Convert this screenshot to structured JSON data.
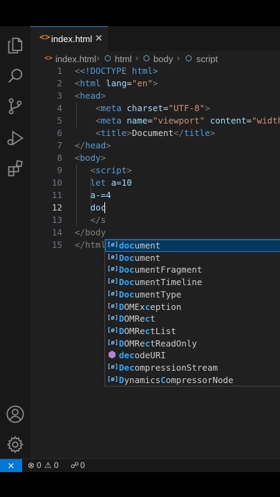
{
  "tab": {
    "icon": "html-file-icon",
    "label": "index.html",
    "close": "✕"
  },
  "breadcrumb": {
    "file": "index.html",
    "items": [
      "html",
      "body",
      "script"
    ]
  },
  "line_numbers": [
    "1",
    "2",
    "3",
    "4",
    "5",
    "6",
    "7",
    "8",
    "9",
    "10",
    "11",
    "12",
    "13",
    "14",
    "15"
  ],
  "active_line": "12",
  "code": {
    "l1": "<!DOCTYPE html>",
    "l2_tag": "html",
    "l2_attr": "lang",
    "l2_val": "\"en\"",
    "l3": "head",
    "l4_tag": "meta",
    "l4_attr": "charset",
    "l4_val": "\"UTF-8\"",
    "l5_tag": "meta",
    "l5_attr1": "name",
    "l5_val1": "\"viewport\"",
    "l5_attr2": "content",
    "l5_val2": "\"width=",
    "l6_tag": "title",
    "l6_text": "Document",
    "l7": "head",
    "l8": "body",
    "l9": "script",
    "l10_kw": "let",
    "l10_rest": "a=10",
    "l11": "a-=4",
    "l12": "doc",
    "l13": "</s",
    "l14": "</body",
    "l15": "</html"
  },
  "suggestions": [
    {
      "icon": "variable-icon",
      "match": "doc",
      "rest": "ument"
    },
    {
      "icon": "variable-icon",
      "match": "Doc",
      "rest": "ument"
    },
    {
      "icon": "variable-icon",
      "match": "Doc",
      "rest": "umentFragment"
    },
    {
      "icon": "variable-icon",
      "match": "Doc",
      "rest": "umentTimeline"
    },
    {
      "icon": "variable-icon",
      "match": "Doc",
      "rest": "umentType"
    },
    {
      "icon": "variable-icon",
      "pre": "",
      "parts": [
        "D",
        "OMEx",
        "c",
        "eption"
      ]
    },
    {
      "icon": "variable-icon",
      "parts": [
        "D",
        "OMRe",
        "c",
        "t"
      ]
    },
    {
      "icon": "variable-icon",
      "parts": [
        "D",
        "OMRe",
        "c",
        "tList"
      ]
    },
    {
      "icon": "variable-icon",
      "parts": [
        "D",
        "OMRe",
        "c",
        "tReadOnly"
      ]
    },
    {
      "icon": "function-icon",
      "parts": [
        "d",
        "e",
        "c",
        "odeURI"
      ]
    },
    {
      "icon": "variable-icon",
      "parts": [
        "D",
        "e",
        "c",
        "ompressionStream"
      ]
    },
    {
      "icon": "variable-icon",
      "parts": [
        "D",
        "ynamics",
        "C",
        "ompressorNode"
      ]
    }
  ],
  "status": {
    "remote": "remote-icon",
    "errors": "0",
    "warnings": "0",
    "ports": "0"
  },
  "colors": {
    "accent": "#0078d4",
    "selection": "#04395e",
    "match": "#2aaaff"
  }
}
